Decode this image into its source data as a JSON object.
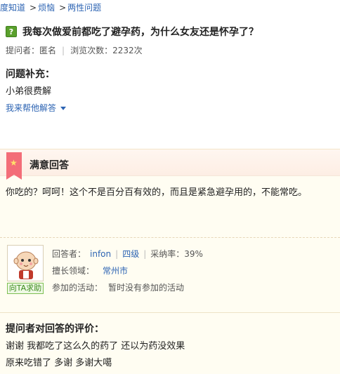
{
  "breadcrumb": {
    "items": [
      "度知道",
      "烦恼",
      "两性问题"
    ],
    "separator": ">"
  },
  "question": {
    "icon": "question-icon",
    "title": "我每次做爱前都吃了避孕药，为什么女友还是怀孕了？",
    "asker_label": "提问者：匿名",
    "views_label": "浏览次数：2232次"
  },
  "supplement": {
    "title": "问题补充：",
    "body": "小弟很费解"
  },
  "help_link": {
    "label": "我来帮他解答"
  },
  "answer": {
    "header": "满意回答",
    "body": "你吃的？呵呵！这个不是百分百有效的，而且是紧急避孕用的，不能常吃。",
    "answerer_label": "回答者：",
    "answerer_name": "infon",
    "level": "四级",
    "adoption_rate": "采纳率：39%",
    "expertise_label": "擅长领域：",
    "expertise_value": "常州市",
    "activity_label": "参加的活动：",
    "activity_value": "暂时没有参加的活动",
    "ask_button": "向TA求助"
  },
  "evaluation": {
    "title": "提问者对回答的评价：",
    "lines": [
      "谢谢 我都吃了这么久的药了 还以为药没效果",
      "原来吃错了 多谢 多谢大噶"
    ]
  },
  "colors": {
    "link": "#2d64b3",
    "ribbon": "#f36d78",
    "answer_bg": "#fffdf2",
    "question_icon": "#5aa02c"
  }
}
